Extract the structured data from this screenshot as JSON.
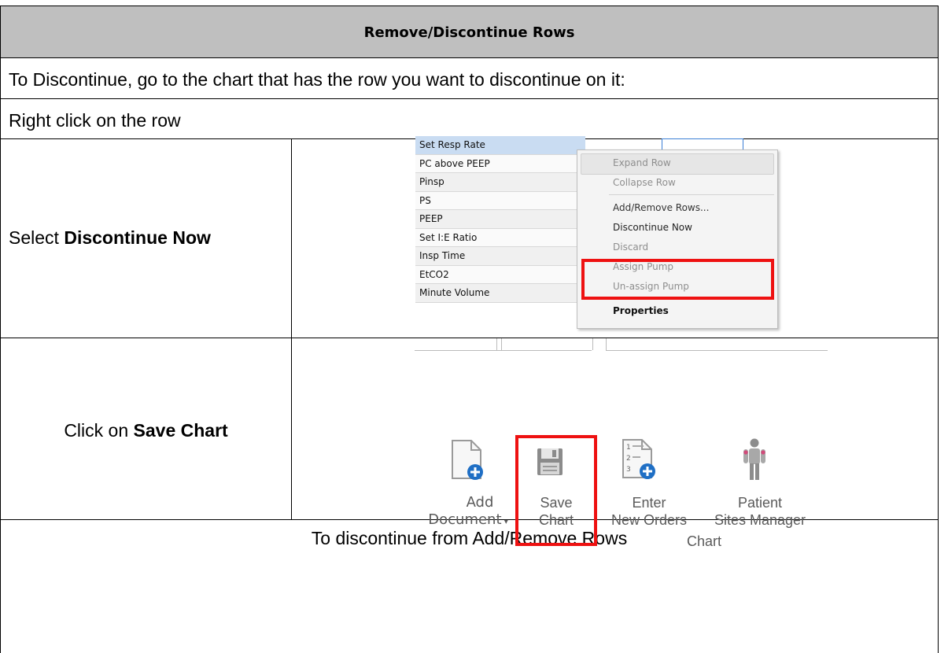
{
  "header": {
    "title": "Remove/Discontinue Rows"
  },
  "steps": {
    "intro": "To Discontinue, go to the chart that has the row you want to discontinue on it:",
    "right_click": "Right click on the row",
    "select_prefix": "Select ",
    "select_bold": "Discontinue Now",
    "click_prefix": "Click on ",
    "click_bold": "Save Chart",
    "footer": "To discontinue from Add/Remove Rows"
  },
  "row_list": [
    "Set Resp Rate",
    "PC above PEEP",
    "Pinsp",
    "PS",
    "PEEP",
    "Set I:E Ratio",
    "Insp Time",
    "EtCO2",
    "Minute Volume"
  ],
  "context_menu": {
    "expand_row": "Expand Row",
    "collapse_row": "Collapse Row",
    "add_remove_rows": "Add/Remove Rows...",
    "discontinue_now": "Discontinue Now",
    "discard": "Discard",
    "assign_pump": "Assign Pump",
    "unassign_pump": "Un-assign Pump",
    "properties": "Properties"
  },
  "toolbar": {
    "add_document_line1": "Add",
    "add_document_line2": "Document",
    "save_chart_line1": "Save",
    "save_chart_line2": "Chart",
    "enter_orders_line1": "Enter",
    "enter_orders_line2": "New Orders",
    "patient_sites_line1": "Patient",
    "patient_sites_line2": "Sites Manager",
    "group_label": "Chart"
  },
  "icons": {
    "add_document": "document-plus-icon",
    "save_chart": "floppy-disk-icon",
    "enter_orders": "numbered-list-plus-icon",
    "patient_sites": "person-figure-icon"
  },
  "colors": {
    "header_bg": "#bfbfbf",
    "highlight_red": "#ee1111",
    "selection_blue": "#c9dcf2",
    "badge_blue": "#1f6fc5"
  }
}
